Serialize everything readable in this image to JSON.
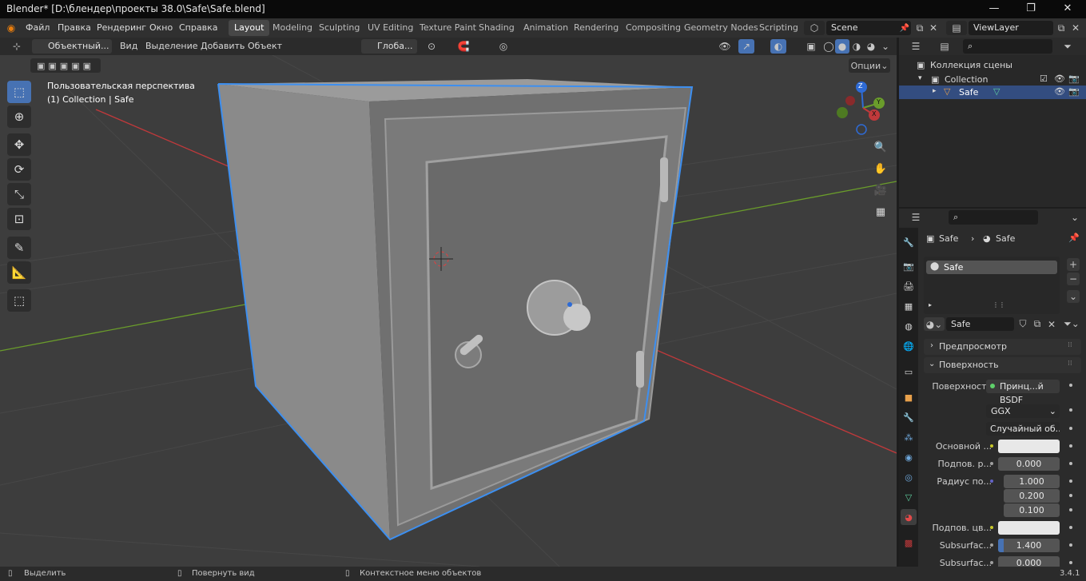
{
  "window": {
    "title": "Blender* [D:\\блендер\\проекты 38.0\\Safe\\Safe.blend]",
    "controls": [
      "—",
      "❐",
      "✕"
    ]
  },
  "menu": {
    "items": [
      "Файл",
      "Правка",
      "Рендеринг",
      "Окно",
      "Справка"
    ]
  },
  "workspaces": [
    "Layout",
    "Modeling",
    "Sculpting",
    "UV Editing",
    "Texture Paint",
    "Shading",
    "Animation",
    "Rendering",
    "Compositing",
    "Geometry Nodes",
    "Scripting"
  ],
  "scene": {
    "name": "Scene",
    "view_layer": "ViewLayer"
  },
  "viewport": {
    "mode": "Объектный...",
    "menus": [
      "Вид",
      "Выделение",
      "Добавить",
      "Объект"
    ],
    "orientation": "Глоба...",
    "options_label": "Опции",
    "overlay_title": "Пользовательская перспектива",
    "overlay_sub": "(1) Collection | Safe",
    "gizmo": {
      "z": "Z",
      "y": "Y",
      "x": "X"
    }
  },
  "outliner": {
    "collection_root": "Коллекция сцены",
    "collection": "Collection",
    "object": "Safe"
  },
  "properties": {
    "breadcrumb_obj": "Safe",
    "breadcrumb_mat": "Safe",
    "slot": "Safe",
    "material_name": "Safe",
    "panel_preview": "Предпросмотр",
    "panel_surface": "Поверхность",
    "surface_label": "Поверхность",
    "surface_value": "Принц...й BSDF",
    "distribution": "GGX",
    "subsurface_method": "Случайный об...",
    "rows": {
      "base_color": "Основной ...",
      "subsurface": {
        "label": "Подпов. р...",
        "value": "0.000"
      },
      "radius": {
        "label": "Радиус по...",
        "v1": "1.000",
        "v2": "0.200",
        "v3": "0.100"
      },
      "subsurface_color": "Подпов. цв...",
      "sub_ior": {
        "label": "Subsurfac...",
        "value": "1.400"
      },
      "sub_aniso": {
        "label": "Subsurfac...",
        "value": "0.000"
      }
    }
  },
  "statusbar": {
    "select": "Выделить",
    "rotate": "Повернуть вид",
    "context": "Контекстное меню объектов",
    "version": "3.4.1"
  },
  "colors": {
    "accent": "#4772b3",
    "selection_outline": "#3d8ff0",
    "axis_x": "#c0393b",
    "axis_y": "#6a9c2b"
  }
}
